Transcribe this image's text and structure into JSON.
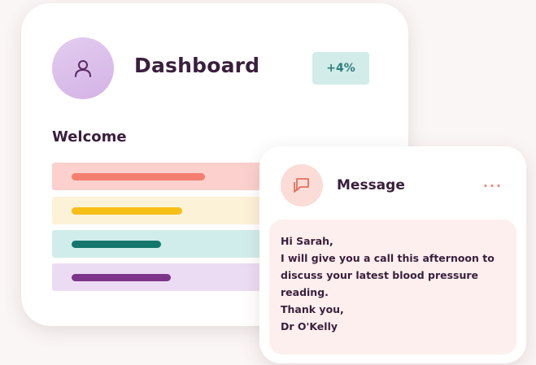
{
  "dashboard": {
    "title": "Dashboard",
    "badge": "+4%",
    "welcome": "Welcome",
    "avatar_icon": "user-icon",
    "bars": [
      {
        "track_color": "#fbd0cd",
        "fill_color": "#f47f70"
      },
      {
        "track_color": "#fcf2d8",
        "fill_color": "#f6be17"
      },
      {
        "track_color": "#d1edeb",
        "fill_color": "#14766d"
      },
      {
        "track_color": "#ecdcf3",
        "fill_color": "#7c3588"
      }
    ]
  },
  "message": {
    "title": "Message",
    "icon": "chat-bubble-icon",
    "more_icon": "more-dots-icon",
    "lines": [
      "Hi Sarah,",
      "I will give you a call this afternoon to",
      "discuss your latest blood pressure",
      "reading.",
      "Thank you,",
      "Dr O'Kelly"
    ]
  },
  "colors": {
    "text": "#3a1f3d",
    "accent_coral": "#f18a7a",
    "badge_bg": "#d1ece9",
    "badge_text": "#2e7d78",
    "avatar_bg": "#d4b3e6",
    "message_bg": "#fcefed"
  }
}
